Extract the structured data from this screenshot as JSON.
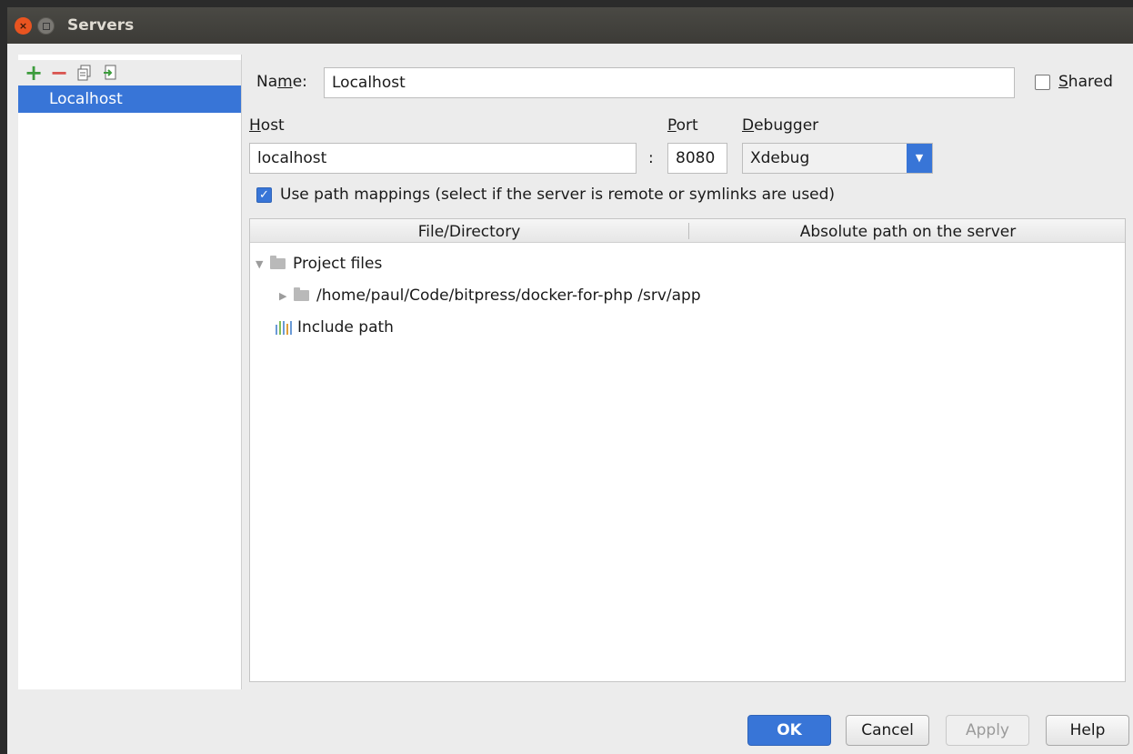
{
  "window": {
    "title": "Servers"
  },
  "toolbar": {
    "icons": [
      "plus-icon",
      "minus-icon",
      "copy-icon",
      "import-icon"
    ]
  },
  "servers": [
    {
      "name": "Localhost"
    }
  ],
  "form": {
    "name_label_pre": "Na",
    "name_label_u": "m",
    "name_label_post": "e:",
    "name_value": "Localhost",
    "shared_label_u": "S",
    "shared_label_post": "hared",
    "shared_checked": false,
    "host_label_u": "H",
    "host_label_post": "ost",
    "host_value": "localhost",
    "colon": ":",
    "port_label_u": "P",
    "port_label_post": "ort",
    "port_value": "8080",
    "debugger_label_u": "D",
    "debugger_label_post": "ebugger",
    "debugger_value": "Xdebug",
    "path_mappings_label": "Use path mappings (select if the server is remote or symlinks are used)",
    "path_mappings_checked": true
  },
  "table": {
    "columns": [
      "File/Directory",
      "Absolute path on the server"
    ],
    "rows": [
      {
        "label": "Project files",
        "expanded": true,
        "server_path": ""
      },
      {
        "label": "/home/paul/Code/bitpress/docker-for-php",
        "expanded": false,
        "server_path": "/srv/app"
      },
      {
        "label": "Include path",
        "server_path": ""
      }
    ]
  },
  "buttons": {
    "ok": "OK",
    "cancel": "Cancel",
    "apply": "Apply",
    "help": "Help"
  },
  "colors": {
    "accent": "#3875d7",
    "titlebar": "#3c3b37",
    "close": "#e95420"
  }
}
